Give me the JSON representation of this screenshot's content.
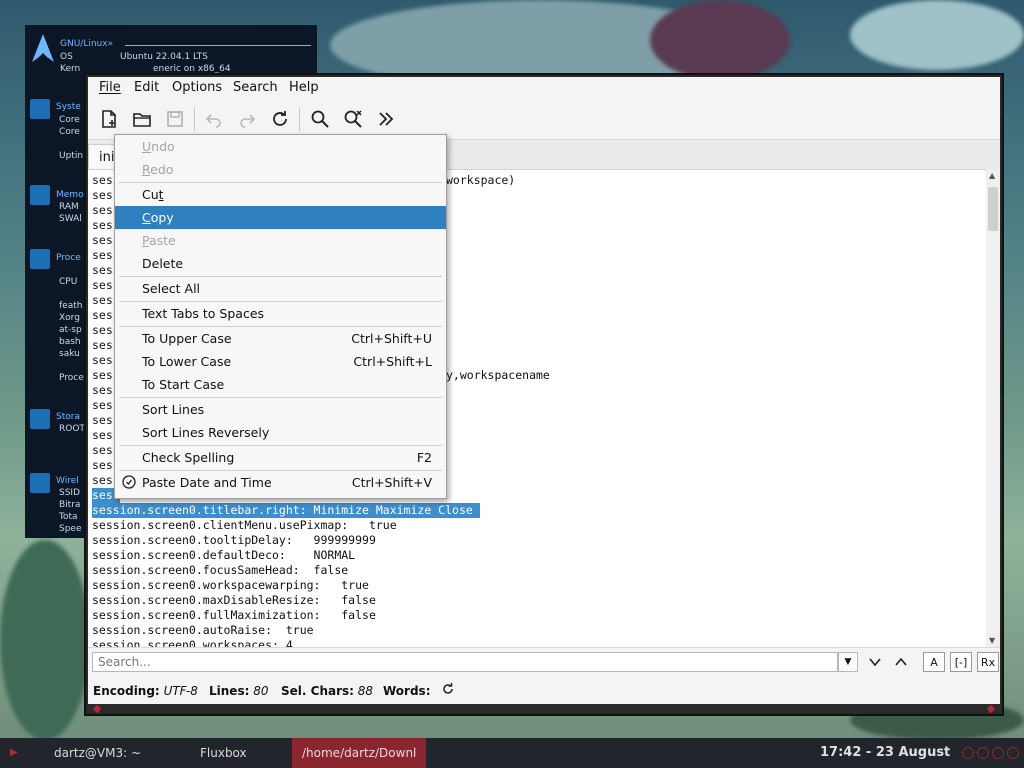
{
  "conky": {
    "distro": "GNU/Linux»",
    "os_label": "OS",
    "os_value": "Ubuntu 22.04.1 LTS",
    "kernel_label": "Kern",
    "kernel_value": "eneric on x86_64",
    "sections": [
      "Syste",
      "Memo",
      "Proce",
      "Stora",
      "Wirel"
    ],
    "system_rows": [
      "Core",
      "Core",
      "Uptin"
    ],
    "memory_rows": [
      "RAM",
      "SWAl"
    ],
    "process_rows": [
      "CPU",
      "feath",
      "Xorg",
      "at-sp",
      "bash",
      "saku",
      "Proce"
    ],
    "storage_rows": [
      "ROOT"
    ],
    "wireless_rows": [
      "SSID",
      "Bitra",
      "Tota",
      "Spee"
    ]
  },
  "menubar": {
    "file": "File",
    "edit": "Edit",
    "options": "Options",
    "search": "Search",
    "help": "Help"
  },
  "toolbar": {
    "icons": [
      "new-document-icon",
      "open-folder-icon",
      "save-icon",
      "undo-icon",
      "redo-icon",
      "reload-icon",
      "find-icon",
      "find-replace-icon",
      "more-icon"
    ]
  },
  "tab": {
    "label": "ini"
  },
  "editor": {
    "lines": [
      {
        "text": "sess",
        "selected": false
      },
      {
        "text": "sess",
        "selected": false
      },
      {
        "text": "sess",
        "selected": false
      },
      {
        "text": "sess",
        "selected": false
      },
      {
        "text": "sess",
        "selected": false
      },
      {
        "text": "sess",
        "selected": false
      },
      {
        "text": "sess",
        "selected": false
      },
      {
        "text": "sess",
        "selected": false
      },
      {
        "text": "sess",
        "selected": false
      },
      {
        "text": "sess",
        "selected": false
      },
      {
        "text": "sess",
        "selected": false
      },
      {
        "text": "sess",
        "selected": false
      },
      {
        "text": "sess",
        "selected": false
      },
      {
        "text": "sess",
        "selected": false
      },
      {
        "text": "sess",
        "selected": false
      },
      {
        "text": "sess",
        "selected": false
      },
      {
        "text": "sess",
        "selected": false
      },
      {
        "text": "sess",
        "selected": false
      },
      {
        "text": "sess",
        "selected": false
      },
      {
        "text": "sess",
        "selected": false
      },
      {
        "text": "sess",
        "selected": false
      },
      {
        "text": "sess",
        "selected": true
      },
      {
        "text": "session.screen0.titlebar.right: Minimize Maximize Close ",
        "selected": true
      },
      {
        "text": "session.screen0.clientMenu.usePixmap:   true",
        "selected": false
      },
      {
        "text": "session.screen0.tooltipDelay:   999999999",
        "selected": false
      },
      {
        "text": "session.screen0.defaultDeco:    NORMAL",
        "selected": false
      },
      {
        "text": "session.screen0.focusSameHead:  false",
        "selected": false
      },
      {
        "text": "session.screen0.workspacewarping:   true",
        "selected": false
      },
      {
        "text": "session.screen0.maxDisableResize:   false",
        "selected": false
      },
      {
        "text": "session.screen0.fullMaximization:   false",
        "selected": false
      },
      {
        "text": "session.screen0.autoRaise:  true",
        "selected": false
      },
      {
        "text": "session.screen0.workspaces: 4",
        "selected": false
      }
    ],
    "right_fragments": [
      {
        "line": 0,
        "text": "workspace)"
      },
      {
        "line": 13,
        "text": "y,workspacename"
      }
    ]
  },
  "context_menu": {
    "items": [
      {
        "label": "Undo",
        "accel": "",
        "disabled": true,
        "highlighted": false,
        "mnemonic": 0
      },
      {
        "label": "Redo",
        "accel": "",
        "disabled": true,
        "highlighted": false,
        "mnemonic": 0
      },
      {
        "separator": true
      },
      {
        "label": "Cut",
        "accel": "",
        "disabled": false,
        "highlighted": false,
        "mnemonic": 2
      },
      {
        "label": "Copy",
        "accel": "",
        "disabled": false,
        "highlighted": true,
        "mnemonic": 0
      },
      {
        "label": "Paste",
        "accel": "",
        "disabled": true,
        "highlighted": false,
        "mnemonic": 0
      },
      {
        "label": "Delete",
        "accel": "",
        "disabled": false,
        "highlighted": false
      },
      {
        "separator": true
      },
      {
        "label": "Select All",
        "accel": "",
        "disabled": false,
        "highlighted": false
      },
      {
        "separator": true
      },
      {
        "label": "Text Tabs to Spaces",
        "accel": "",
        "disabled": false,
        "highlighted": false
      },
      {
        "separator": true
      },
      {
        "label": "To Upper Case",
        "accel": "Ctrl+Shift+U",
        "disabled": false,
        "highlighted": false
      },
      {
        "label": "To Lower Case",
        "accel": "Ctrl+Shift+L",
        "disabled": false,
        "highlighted": false
      },
      {
        "label": "To Start Case",
        "accel": "",
        "disabled": false,
        "highlighted": false
      },
      {
        "separator": true
      },
      {
        "label": "Sort Lines",
        "accel": "",
        "disabled": false,
        "highlighted": false
      },
      {
        "label": "Sort Lines Reversely",
        "accel": "",
        "disabled": false,
        "highlighted": false
      },
      {
        "separator": true
      },
      {
        "label": "Check Spelling",
        "accel": "F2",
        "disabled": false,
        "highlighted": false
      },
      {
        "separator": true
      },
      {
        "label": "Paste Date and Time",
        "accel": "Ctrl+Shift+V",
        "disabled": false,
        "highlighted": false,
        "icon": "clock-icon"
      }
    ]
  },
  "searchbar": {
    "placeholder": "Search...",
    "buttons": [
      "next-match-icon",
      "previous-match-icon"
    ],
    "toggles": [
      "A",
      "[-]",
      "Rx"
    ]
  },
  "statusbar": {
    "encoding_label": "Encoding:",
    "encoding_value": "UTF-8",
    "lines_label": "Lines:",
    "lines_value": "80",
    "selchars_label": "Sel. Chars:",
    "selchars_value": "88",
    "words_label": "Words:"
  },
  "taskbar": {
    "user_host": "dartz@VM3: ~",
    "wm": "Fluxbox",
    "path": "/home/dartz/Downl",
    "clock": "17:42 - 23 August"
  },
  "colors": {
    "selection": "#3d8ecf",
    "menu_highlight": "#2f7fc1",
    "taskbar_accent": "#8a2630",
    "conky_bg": "#0b1726",
    "conky_accent": "#6fb6ff"
  }
}
